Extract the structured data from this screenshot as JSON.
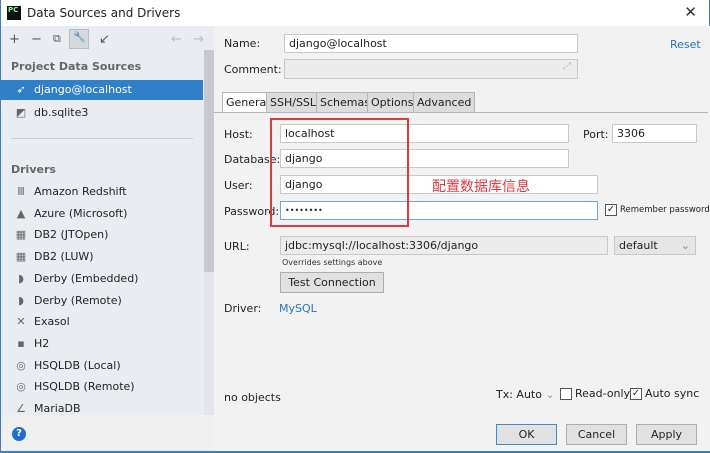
{
  "window": {
    "title": "Data Sources and Drivers",
    "app_icon": "PC",
    "close": "✕"
  },
  "toolbar": {
    "add": "+",
    "remove": "−",
    "duplicate": "⧉",
    "wrench": "🔧",
    "import": "↙",
    "back": "←",
    "forward": "→"
  },
  "sidebar": {
    "project_header": "Project Data Sources",
    "project_items": [
      {
        "label": "django@localhost",
        "icon": "mysql-dolphin-icon",
        "selected": true
      },
      {
        "label": "db.sqlite3",
        "icon": "sqlite-icon"
      }
    ],
    "drivers_header": "Drivers",
    "drivers": [
      {
        "label": "Amazon Redshift",
        "icon": "Ⅲ"
      },
      {
        "label": "Azure (Microsoft)",
        "icon": "▲"
      },
      {
        "label": "DB2 (JTOpen)",
        "icon": "▦"
      },
      {
        "label": "DB2 (LUW)",
        "icon": "▦"
      },
      {
        "label": "Derby (Embedded)",
        "icon": "◗"
      },
      {
        "label": "Derby (Remote)",
        "icon": "◗"
      },
      {
        "label": "Exasol",
        "icon": "✕"
      },
      {
        "label": "H2",
        "icon": "▪"
      },
      {
        "label": "HSQLDB (Local)",
        "icon": "◎"
      },
      {
        "label": "HSQLDB (Remote)",
        "icon": "◎"
      },
      {
        "label": "MariaDB",
        "icon": "∠"
      }
    ],
    "help": "?"
  },
  "form": {
    "name_label": "Name:",
    "name_value": "django@localhost",
    "reset": "Reset",
    "comment_label": "Comment:",
    "comment_value": "",
    "tabs": [
      "General",
      "SSH/SSL",
      "Schemas",
      "Options",
      "Advanced"
    ],
    "active_tab": "General",
    "host_label": "Host:",
    "host_value": "localhost",
    "port_label": "Port:",
    "port_value": "3306",
    "database_label": "Database:",
    "database_value": "django",
    "user_label": "User:",
    "user_value": "django",
    "password_label": "Password:",
    "password_value": "••••••••",
    "remember_password": "Remember password",
    "remember_checked": true,
    "annotation": "配置数据库信息",
    "url_label": "URL:",
    "url_value": "jdbc:mysql://localhost:3306/django",
    "url_mode": "default",
    "overrides_note": "Overrides settings above",
    "test_connection": "Test Connection",
    "driver_label": "Driver:",
    "driver_value": "MySQL"
  },
  "footer": {
    "status": "no objects",
    "tx": "Tx: Auto",
    "read_only": "Read-only",
    "read_only_checked": false,
    "auto_sync": "Auto sync",
    "auto_sync_checked": true,
    "ok": "OK",
    "cancel": "Cancel",
    "apply": "Apply"
  }
}
